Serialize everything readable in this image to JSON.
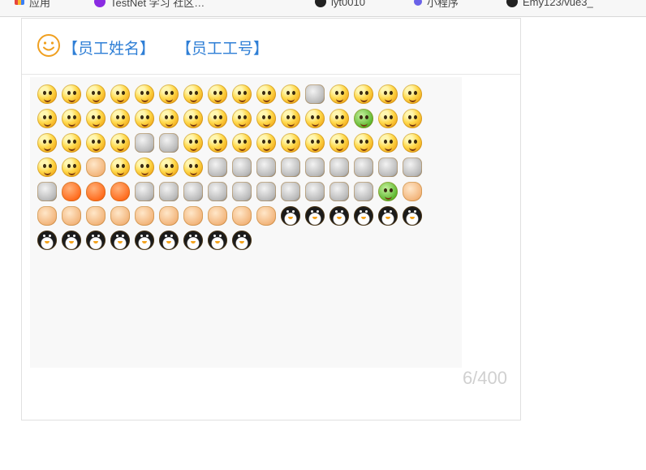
{
  "bookmarks": {
    "items": [
      {
        "label": "应用",
        "icon": "apps-grid-icon"
      },
      {
        "label": "TestNet 学习 社区…",
        "icon": "purple-circle-icon"
      },
      {
        "label": "lyt0010",
        "icon": "github-icon"
      },
      {
        "label": "小程序",
        "icon": "blue-dot-icon"
      },
      {
        "label": "Emy123/vue3_",
        "icon": "github-icon"
      }
    ]
  },
  "header": {
    "emoji_button_icon": "smile-face-icon",
    "tags": [
      "【员工姓名】",
      "【员工工号】"
    ]
  },
  "editor": {
    "emoji_count": 107,
    "rows": [
      [
        "smile",
        "frown",
        "love-eyes",
        "kiss",
        "cool",
        "tongue",
        "giggle",
        "shock",
        "sad",
        "cry",
        "angry",
        "fire",
        "grin",
        "laugh",
        "think",
        "pout"
      ],
      [
        "evil",
        "sleepy",
        "cover-face",
        "blush",
        "shy",
        "happy",
        "surprised",
        "worried",
        "confused",
        "blank",
        "mad",
        "sick",
        "cheer",
        "soldier",
        "ninja",
        "amazed"
      ],
      [
        "question",
        "whisper",
        "dizzy",
        "tears",
        "skull-black",
        "skull",
        "peek",
        "hide",
        "grab",
        "tired",
        "sweat",
        "kiss2",
        "stare",
        "nose",
        "sleep",
        "hmm"
      ],
      [
        "hug",
        "droop",
        "clap",
        "smirk",
        "whistle",
        "scared",
        "frantic",
        "knife",
        "watermelon",
        "beer",
        "basketball",
        "pingpong",
        "coffee",
        "rice",
        "pig",
        "rose"
      ],
      [
        "wilted-rose",
        "heart",
        "heart2",
        "broken-heart",
        "cake",
        "lightning",
        "bomb",
        "dagger",
        "soccer",
        "ladybug",
        "poop",
        "moon",
        "sun",
        "gift",
        "hug-green",
        "thumbs-up"
      ],
      [
        "thumbs-down",
        "handshake",
        "victory",
        "fist-bump",
        "beckon",
        "fist",
        "point",
        "rock",
        "peace",
        "ok",
        "penguin-kiss",
        "penguin-love",
        "penguin-dance",
        "penguin-run",
        "penguin-jump",
        "penguin-wave"
      ],
      [
        "penguin-sit",
        "penguin-cool",
        "penguin-walk",
        "penguin-bow",
        "penguin-stand",
        "penguin-gift",
        "penguin-hat",
        "penguin-pair",
        "penguin-pair2"
      ]
    ]
  },
  "counter": {
    "text": "6/400"
  },
  "colors": {
    "tag": "#2f7fd6",
    "smile_icon": "#f0a020",
    "counter": "#d0d0d0"
  }
}
